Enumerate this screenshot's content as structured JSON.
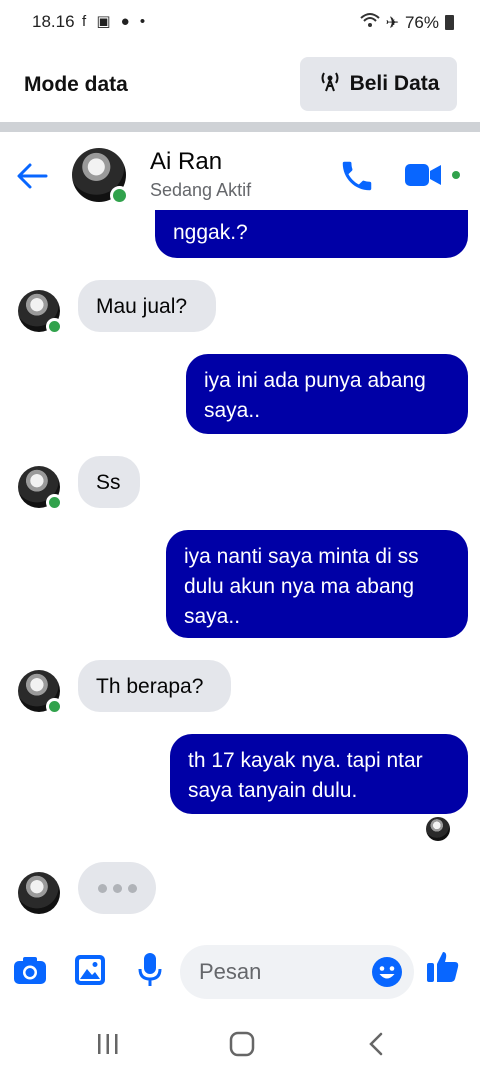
{
  "status_bar": {
    "time": "18.16",
    "left_icons": "f ▣ ● •",
    "battery": "76%"
  },
  "data_bar": {
    "title": "Mode data",
    "button_label": "Beli Data"
  },
  "chat_header": {
    "name": "Ai Ran",
    "status": "Sedang Aktif"
  },
  "messages": [
    {
      "from": "me",
      "text": "nggak.?"
    },
    {
      "from": "them",
      "text": "Mau jual?"
    },
    {
      "from": "me",
      "text": "iya ini ada punya abang saya.."
    },
    {
      "from": "them",
      "text": "Ss"
    },
    {
      "from": "me",
      "text": "iya nanti saya minta di ss dulu akun nya ma abang saya.."
    },
    {
      "from": "them",
      "text": "Th berapa?"
    },
    {
      "from": "me",
      "text": "th 17 kayak nya. tapi ntar saya tanyain dulu."
    }
  ],
  "composer": {
    "placeholder": "Pesan"
  },
  "colors": {
    "accent": "#0866ff",
    "outgoing": "#0000a6",
    "incoming": "#e4e6eb",
    "online": "#31a24c"
  }
}
